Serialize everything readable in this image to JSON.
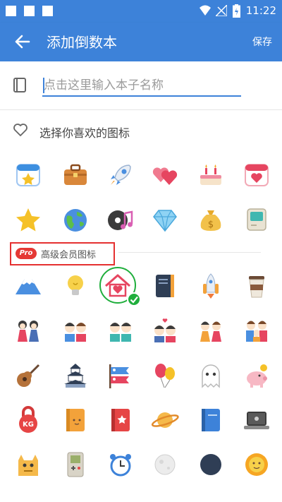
{
  "status_bar": {
    "time": "11:22"
  },
  "app_bar": {
    "title": "添加倒数本",
    "save_label": "保存"
  },
  "name_field": {
    "placeholder": "点击这里输入本子名称",
    "value": ""
  },
  "icon_section": {
    "label": "选择你喜欢的图标"
  },
  "premium_section": {
    "badge": "Pro",
    "label": "高级会员图标"
  },
  "free_icons": [
    "calendar-star-icon",
    "briefcase-icon",
    "rocket-icon",
    "hearts-icon",
    "birthday-cake-icon",
    "calendar-heart-icon",
    "star-icon",
    "globe-icon",
    "music-disc-icon",
    "diamond-icon",
    "money-bag-icon",
    "retro-computer-icon"
  ],
  "premium_icons": [
    "mount-fuji-icon",
    "lightbulb-icon",
    "house-heart-icon",
    "notebook-icon",
    "space-shuttle-icon",
    "coffee-cup-icon",
    "japanese-dolls-icon",
    "couple-icon",
    "twin-boys-icon",
    "couple-hearts-icon",
    "kimono-couple-icon",
    "family-icon",
    "guitar-icon",
    "japanese-castle-icon",
    "koinobori-icon",
    "balloons-icon",
    "ghost-icon",
    "piggy-bank-icon",
    "kettlebell-icon",
    "cute-book-icon",
    "red-book-icon",
    "saturn-icon",
    "blue-book-icon",
    "laptop-icon",
    "monster-icon",
    "gameboy-icon",
    "alarm-clock-icon",
    "moon-icon",
    "crescent-moon-icon",
    "sun-face-icon"
  ],
  "selected_icon": "house-heart-icon",
  "colors": {
    "primary": "#3d82d9",
    "pro_badge": "#e53935",
    "selected": "#1fae3c"
  }
}
